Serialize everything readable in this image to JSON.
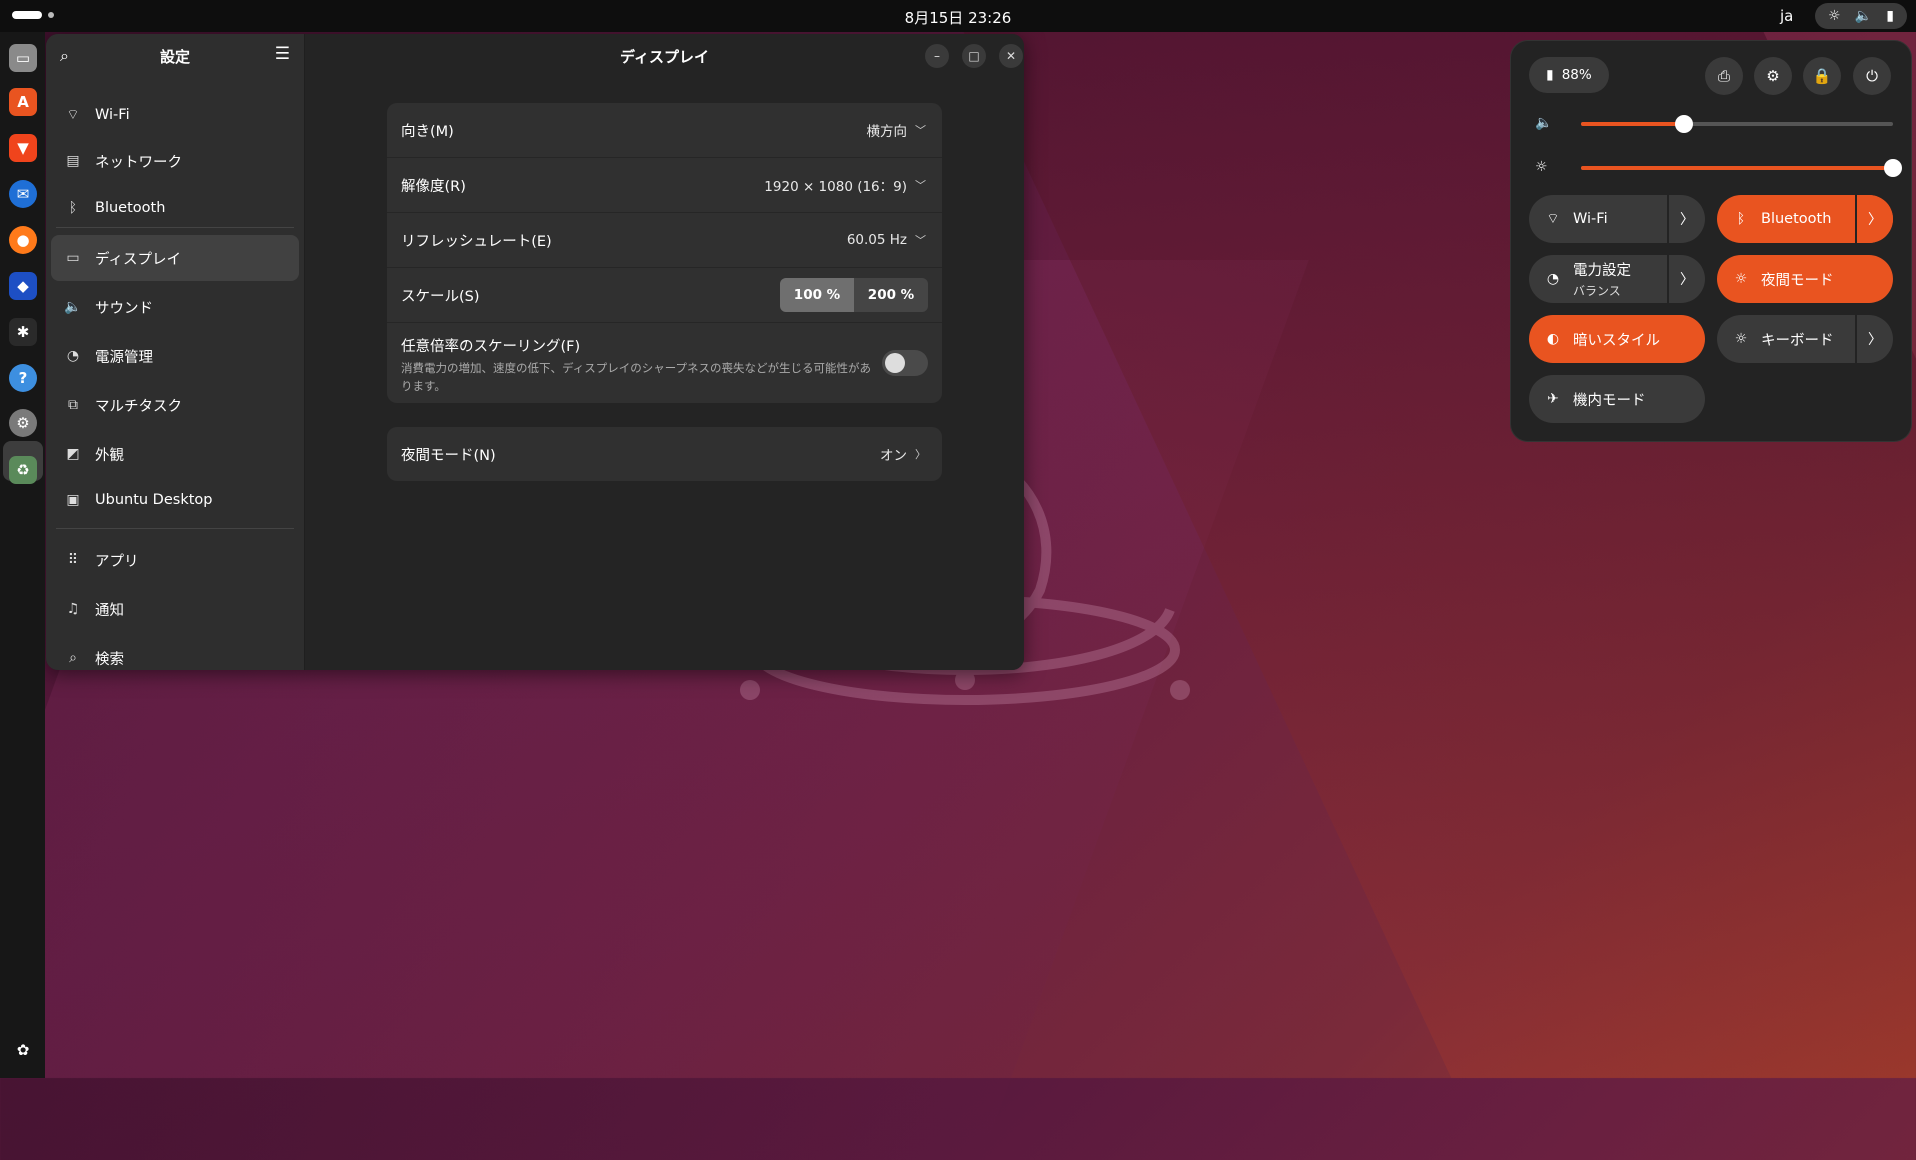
{
  "topbar": {
    "clock": "8月15日 23:26",
    "lang": "ja"
  },
  "sidebar": {
    "title": "設定",
    "items": [
      {
        "label": "Wi-Fi"
      },
      {
        "label": "ネットワーク"
      },
      {
        "label": "Bluetooth"
      },
      {
        "label": "ディスプレイ"
      },
      {
        "label": "サウンド"
      },
      {
        "label": "電源管理"
      },
      {
        "label": "マルチタスク"
      },
      {
        "label": "外観"
      },
      {
        "label": "Ubuntu Desktop"
      },
      {
        "label": "アプリ"
      },
      {
        "label": "通知"
      },
      {
        "label": "検索"
      }
    ]
  },
  "display": {
    "title": "ディスプレイ",
    "orientation": {
      "label": "向き(M)",
      "value": "横方向"
    },
    "resolution": {
      "label": "解像度(R)",
      "value": "1920 × 1080 (16：9)"
    },
    "refresh": {
      "label": "リフレッシュレート(E)",
      "value": "60.05 Hz"
    },
    "scale": {
      "label": "スケール(S)",
      "options": [
        "100 %",
        "200 %"
      ],
      "selected": "100 %"
    },
    "fractional": {
      "label": "任意倍率のスケーリング(F)",
      "description": "消費電力の増加、速度の低下、ディスプレイのシャープネスの喪失などが生じる可能性があります。",
      "enabled": false
    },
    "night": {
      "label": "夜間モード(N)",
      "value": "オン"
    }
  },
  "quick_settings": {
    "battery": "88%",
    "volume_level": 0.33,
    "brightness_level": 1.0,
    "tiles": {
      "wifi": "Wi-Fi",
      "bluetooth": "Bluetooth",
      "power": "電力設定",
      "power_sub": "バランス",
      "night": "夜間モード",
      "dark": "暗いスタイル",
      "keyboard": "キーボード",
      "airplane": "機内モード"
    }
  },
  "colors": {
    "accent": "#e95420",
    "window_bg": "#242424",
    "sidebar_bg": "#2e2e2e",
    "dock_bg": "#171717"
  }
}
